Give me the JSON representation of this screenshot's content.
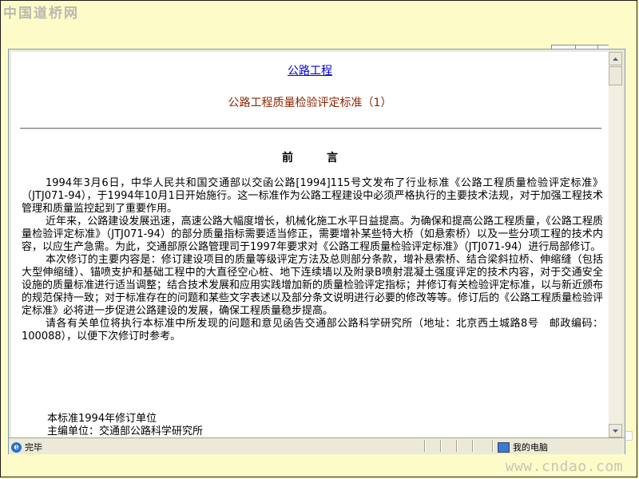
{
  "site_logo": "中国道桥网",
  "watermark": "www.cndao.com",
  "document": {
    "link_text": "公路工程",
    "title": "公路工程质量检验评定标准（1）",
    "section_heading": "前　言",
    "paragraphs": [
      "1994年3月6日，中华人民共和国交通部以交函公路[1994]115号文发布了行业标准《公路工程质量检验评定标准》（JTJ071-94），于1994年10月1日开始施行。这一标准作为公路工程建设中必须严格执行的主要技术法规，对于加强工程技术管理和质量监控起到了重要作用。",
      "近年来，公路建设发展迅速，高速公路大幅度增长，机械化施工水平日益提高。为确保和提高公路工程质量，《公路工程质量检验评定标准》（JTJ071-94）的部分质量指标需要适当修正，需要增补某些特大桥（如悬索桥）以及一些分项工程的技术内容，以应生产急需。为此，交通部原公路管理司于1997年要求对《公路工程质量检验评定标准》（JTJ071-94）进行局部修订。",
      "本次修订的主要内容是：修订建设项目的质量等级评定方法及总则部分条款，增补悬索桥、结合梁斜拉桥、伸缩缝（包括大型伸缩缝）、锚喷支护和基础工程中的大直径空心桩、地下连续墙以及附录B喷射混凝土强度评定的技术内容，对于交通安全设施的质量标准进行适当调整；结合技术发展和应用实践增加新的质量检验评定指标；并修订有关检验评定标准，以与新近颁布的规范保持一致；对于标准存在的问题和某些文字表述以及部分条文说明进行必要的修改等等。修订后的《公路工程质量检验评定标准》必将进一步促进公路建设的发展，确保工程质量稳步提高。",
      "请各有关单位将执行本标准中所发现的问题和意见函告交通部公路科学研究所（地址：北京西土城路8号　邮政编码：100088），以便下次修订时参考。"
    ],
    "signature_line1": "本标准1994年修订单位",
    "signature_line2": "主编单位：交通部公路科学研究所"
  },
  "status_bar": {
    "left_text": "完毕",
    "zone_text": "我的电脑",
    "left_icon": "ie-page-icon",
    "zone_icon": "my-computer-icon"
  },
  "colors": {
    "background": "#fdfcc8",
    "link": "#0000cc",
    "title": "#8b2500"
  }
}
